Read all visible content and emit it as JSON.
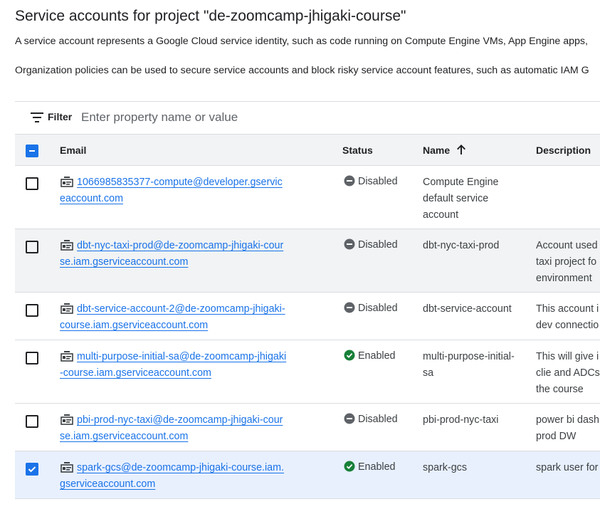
{
  "page": {
    "title": "Service accounts for project \"de-zoomcamp-jhigaki-course\"",
    "description_1": "A service account represents a Google Cloud service identity, such as code running on Compute Engine VMs, App Engine apps,",
    "description_2": "Organization policies can be used to secure service accounts and block risky service account features, such as automatic IAM G"
  },
  "filter": {
    "label": "Filter",
    "placeholder": "Enter property name or value",
    "icon": "filter-icon"
  },
  "table": {
    "columns": {
      "email": "Email",
      "status": "Status",
      "name": "Name",
      "description": "Description"
    },
    "sort": {
      "column": "Name",
      "direction": "ascending",
      "icon": "arrow-up-icon"
    },
    "select_all_state": "indeterminate",
    "rows": [
      {
        "checked": false,
        "email": "1066985835377-compute@developer.gserviceaccount.com",
        "status": "Disabled",
        "name": "Compute Engine default service account",
        "description": ""
      },
      {
        "checked": false,
        "email": "dbt-nyc-taxi-prod@de-zoomcamp-jhigaki-course.iam.gserviceaccount.com",
        "status": "Disabled",
        "name": "dbt-nyc-taxi-prod",
        "description": "Account used\ntaxi project fo\nenvironment"
      },
      {
        "checked": false,
        "email": "dbt-service-account-2@de-zoomcamp-jhigaki-course.iam.gserviceaccount.com",
        "status": "Disabled",
        "name": "dbt-service-account",
        "description": "This account i\ndev connectio"
      },
      {
        "checked": false,
        "email": "multi-purpose-initial-sa@de-zoomcamp-jhigaki-course.iam.gserviceaccount.com",
        "status": "Enabled",
        "name": "multi-purpose-initial-sa",
        "description": "This will give i\nclie and ADCs\nthe course"
      },
      {
        "checked": false,
        "email": "pbi-prod-nyc-taxi@de-zoomcamp-jhigaki-course.iam.gserviceaccount.com",
        "status": "Disabled",
        "name": "pbi-prod-nyc-taxi",
        "description": "power bi dash\nprod DW"
      },
      {
        "checked": true,
        "email": "spark-gcs@de-zoomcamp-jhigaki-course.iam.gserviceaccount.com",
        "status": "Enabled",
        "name": "spark-gcs",
        "description": "spark user for"
      }
    ]
  },
  "colors": {
    "link": "#1a73e8",
    "enabled": "#188038",
    "disabled": "#5f6368",
    "selected_row": "#e8f0fe",
    "header_bg": "#f1f3f4"
  },
  "icons": {
    "row": "service-account-key-icon",
    "enabled": "check-circle-icon",
    "disabled": "minus-circle-icon"
  }
}
